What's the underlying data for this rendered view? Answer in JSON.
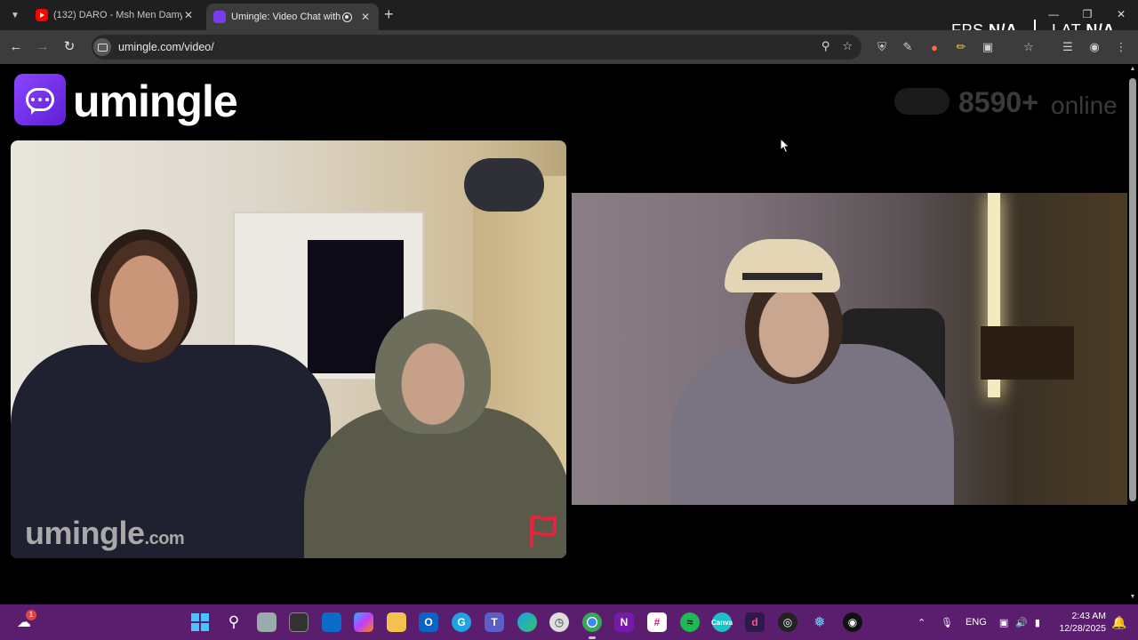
{
  "browser": {
    "tabs": [
      {
        "title": "(132) DARO - Msh Men Damy |",
        "favicon": "youtube-icon",
        "active": false
      },
      {
        "title": "Umingle: Video Chat with St",
        "favicon": "umingle-icon",
        "active": true
      }
    ],
    "url": "umingle.com/video/",
    "new_tab_symbol": "+"
  },
  "overlay": {
    "fps_label": "FPS",
    "fps_value": "N/A",
    "lat_label": "LAT",
    "lat_value": "N/A"
  },
  "site": {
    "logo_text": "umingle",
    "online_count": "8590+",
    "online_label": "online",
    "watermark_main": "umingle",
    "watermark_suffix": ".com",
    "brand_color": "#7a3cf0",
    "flag_color": "#e8243c"
  },
  "taskbar": {
    "language": "ENG",
    "time": "2:43 AM",
    "date": "12/28/2025",
    "weather_badge": "1",
    "accent": "#5b1d6e"
  }
}
